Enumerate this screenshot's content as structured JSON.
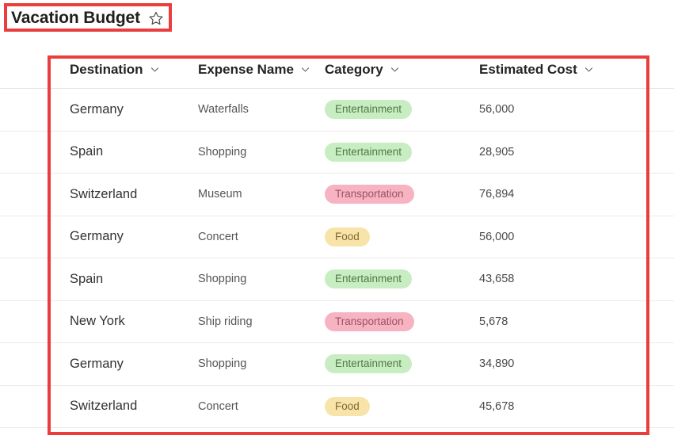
{
  "header": {
    "title": "Vacation Budget",
    "favorite_icon": "star-outline-icon"
  },
  "annotations": {
    "highlight_color": "#ea3d3d"
  },
  "table": {
    "sort_icon": "chevron-down-icon",
    "columns": [
      {
        "key": "destination",
        "label": "Destination"
      },
      {
        "key": "expense_name",
        "label": "Expense Name"
      },
      {
        "key": "category",
        "label": "Category"
      },
      {
        "key": "estimated_cost",
        "label": "Estimated Cost"
      }
    ],
    "category_colors": {
      "Entertainment": "#c8edc2",
      "Transportation": "#f7b3c2",
      "Food": "#f8e3a8"
    },
    "rows": [
      {
        "destination": "Germany",
        "expense_name": "Waterfalls",
        "category": "Entertainment",
        "estimated_cost": "56,000"
      },
      {
        "destination": "Spain",
        "expense_name": "Shopping",
        "category": "Entertainment",
        "estimated_cost": "28,905"
      },
      {
        "destination": "Switzerland",
        "expense_name": "Museum",
        "category": "Transportation",
        "estimated_cost": "76,894"
      },
      {
        "destination": "Germany",
        "expense_name": "Concert",
        "category": "Food",
        "estimated_cost": "56,000"
      },
      {
        "destination": "Spain",
        "expense_name": "Shopping",
        "category": "Entertainment",
        "estimated_cost": "43,658"
      },
      {
        "destination": "New York",
        "expense_name": "Ship riding",
        "category": "Transportation",
        "estimated_cost": "5,678"
      },
      {
        "destination": "Germany",
        "expense_name": "Shopping",
        "category": "Entertainment",
        "estimated_cost": "34,890"
      },
      {
        "destination": "Switzerland",
        "expense_name": "Concert",
        "category": "Food",
        "estimated_cost": "45,678"
      }
    ]
  }
}
